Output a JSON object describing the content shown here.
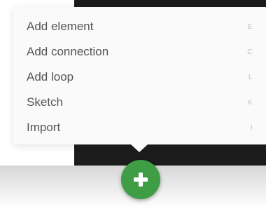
{
  "menu": {
    "items": [
      {
        "label": "Add element",
        "shortcut": "E"
      },
      {
        "label": "Add connection",
        "shortcut": "C"
      },
      {
        "label": "Add loop",
        "shortcut": "L"
      },
      {
        "label": "Sketch",
        "shortcut": "K"
      },
      {
        "label": "Import",
        "shortcut": "I"
      }
    ]
  },
  "fab": {
    "icon": "plus-icon",
    "color": "#3f9e45"
  },
  "colors": {
    "dark_canvas": "#1c1c1c",
    "menu_background": "#fafafa",
    "menu_text": "#555555",
    "shortcut_text": "#c0c0c0"
  }
}
